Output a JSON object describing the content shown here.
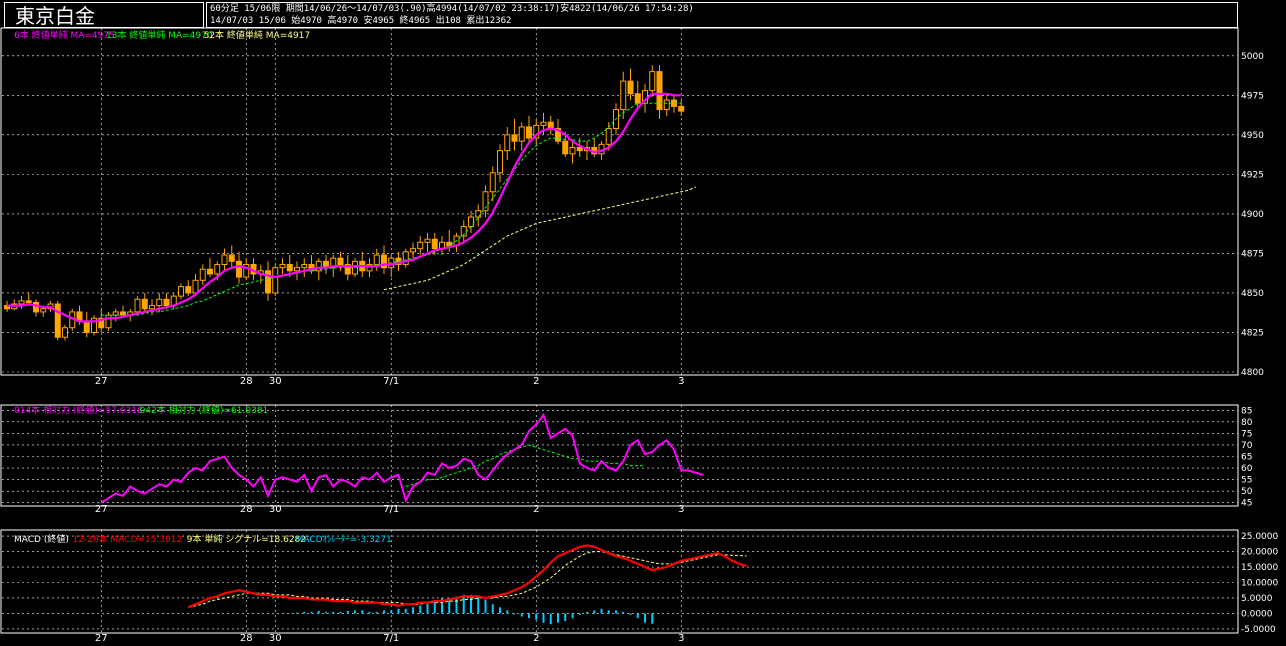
{
  "title": "東京白金",
  "info_line1": "60分足 15/06限 期間14/06/26～14/07/03(.90)高4994(14/07/02 23:38:17)安4822(14/06/26 17:54:28)",
  "info_line2": "14/07/03 15/06 始4970 高4970 安4965 終4965 出108 累出12362",
  "colors": {
    "up": "#ffa500",
    "down": "#ffa500",
    "ma1": "#ff00ff",
    "ma2": "#00ff00",
    "ma3": "#ffff80",
    "rsi1": "#ff00ff",
    "rsi2": "#00ff00",
    "macd": "#ff0000",
    "signal": "#ffff80",
    "osc": "#00ccff",
    "grid": "#ffffff"
  },
  "chart_data": [
    {
      "type": "candlestick",
      "legend": [
        {
          "text": "6本 終値単純 MA=4975",
          "color": "#ff00ff"
        },
        {
          "text": "13本 終値単純 MA=4970",
          "color": "#00ff00"
        },
        {
          "text": "52本 終値単純 MA=4917",
          "color": "#ffff80"
        }
      ],
      "ylim": [
        4800,
        5010
      ],
      "yticks": [
        4800,
        4825,
        4850,
        4875,
        4900,
        4925,
        4950,
        4975,
        5000
      ],
      "x_labels": [
        {
          "i": 13,
          "label": "27"
        },
        {
          "i": 33,
          "label": "28"
        },
        {
          "i": 37,
          "label": "30"
        },
        {
          "i": 53,
          "label": "7/1"
        },
        {
          "i": 73,
          "label": "2"
        },
        {
          "i": 93,
          "label": "3"
        }
      ],
      "candles": [
        [
          4842,
          4845,
          4838,
          4840
        ],
        [
          4840,
          4846,
          4839,
          4843
        ],
        [
          4843,
          4848,
          4840,
          4845
        ],
        [
          4845,
          4850,
          4842,
          4844
        ],
        [
          4844,
          4846,
          4835,
          4838
        ],
        [
          4838,
          4842,
          4835,
          4840
        ],
        [
          4840,
          4845,
          4838,
          4843
        ],
        [
          4843,
          4845,
          4820,
          4822
        ],
        [
          4822,
          4830,
          4820,
          4828
        ],
        [
          4828,
          4840,
          4826,
          4838
        ],
        [
          4838,
          4842,
          4830,
          4832
        ],
        [
          4832,
          4838,
          4822,
          4825
        ],
        [
          4825,
          4836,
          4823,
          4834
        ],
        [
          4834,
          4840,
          4825,
          4828
        ],
        [
          4828,
          4838,
          4826,
          4836
        ],
        [
          4836,
          4840,
          4832,
          4838
        ],
        [
          4838,
          4842,
          4835,
          4836
        ],
        [
          4836,
          4840,
          4832,
          4838
        ],
        [
          4838,
          4848,
          4836,
          4846
        ],
        [
          4846,
          4850,
          4838,
          4840
        ],
        [
          4840,
          4846,
          4836,
          4842
        ],
        [
          4842,
          4850,
          4838,
          4846
        ],
        [
          4846,
          4850,
          4840,
          4842
        ],
        [
          4842,
          4850,
          4840,
          4848
        ],
        [
          4848,
          4856,
          4846,
          4854
        ],
        [
          4854,
          4858,
          4848,
          4850
        ],
        [
          4850,
          4862,
          4848,
          4858
        ],
        [
          4858,
          4868,
          4855,
          4865
        ],
        [
          4865,
          4872,
          4860,
          4862
        ],
        [
          4862,
          4870,
          4858,
          4868
        ],
        [
          4868,
          4878,
          4864,
          4874
        ],
        [
          4874,
          4880,
          4866,
          4870
        ],
        [
          4870,
          4876,
          4856,
          4860
        ],
        [
          4860,
          4872,
          4858,
          4868
        ],
        [
          4868,
          4872,
          4858,
          4862
        ],
        [
          4862,
          4868,
          4856,
          4864
        ],
        [
          4864,
          4870,
          4845,
          4850
        ],
        [
          4850,
          4868,
          4848,
          4866
        ],
        [
          4866,
          4872,
          4862,
          4868
        ],
        [
          4868,
          4874,
          4860,
          4864
        ],
        [
          4864,
          4870,
          4858,
          4866
        ],
        [
          4866,
          4872,
          4860,
          4868
        ],
        [
          4868,
          4874,
          4862,
          4864
        ],
        [
          4864,
          4872,
          4858,
          4870
        ],
        [
          4870,
          4874,
          4862,
          4866
        ],
        [
          4866,
          4874,
          4860,
          4872
        ],
        [
          4872,
          4876,
          4864,
          4868
        ],
        [
          4868,
          4874,
          4858,
          4862
        ],
        [
          4862,
          4872,
          4860,
          4870
        ],
        [
          4870,
          4876,
          4860,
          4864
        ],
        [
          4864,
          4872,
          4860,
          4868
        ],
        [
          4868,
          4878,
          4864,
          4874
        ],
        [
          4874,
          4880,
          4862,
          4866
        ],
        [
          4866,
          4874,
          4860,
          4872
        ],
        [
          4872,
          4876,
          4864,
          4868
        ],
        [
          4868,
          4878,
          4866,
          4876
        ],
        [
          4876,
          4882,
          4872,
          4878
        ],
        [
          4878,
          4886,
          4874,
          4882
        ],
        [
          4882,
          4888,
          4876,
          4884
        ],
        [
          4884,
          4888,
          4874,
          4878
        ],
        [
          4878,
          4886,
          4874,
          4882
        ],
        [
          4882,
          4890,
          4876,
          4880
        ],
        [
          4880,
          4888,
          4876,
          4886
        ],
        [
          4886,
          4896,
          4882,
          4892
        ],
        [
          4892,
          4902,
          4888,
          4898
        ],
        [
          4898,
          4906,
          4892,
          4902
        ],
        [
          4902,
          4918,
          4898,
          4914
        ],
        [
          4914,
          4930,
          4908,
          4926
        ],
        [
          4926,
          4944,
          4920,
          4940
        ],
        [
          4940,
          4955,
          4934,
          4950
        ],
        [
          4950,
          4960,
          4940,
          4946
        ],
        [
          4946,
          4958,
          4940,
          4955
        ],
        [
          4955,
          4962,
          4944,
          4948
        ],
        [
          4948,
          4960,
          4944,
          4956
        ],
        [
          4956,
          4964,
          4950,
          4958
        ],
        [
          4958,
          4962,
          4950,
          4954
        ],
        [
          4954,
          4960,
          4944,
          4946
        ],
        [
          4946,
          4952,
          4936,
          4938
        ],
        [
          4938,
          4946,
          4932,
          4942
        ],
        [
          4942,
          4948,
          4936,
          4940
        ],
        [
          4940,
          4946,
          4934,
          4942
        ],
        [
          4942,
          4948,
          4936,
          4938
        ],
        [
          4938,
          4946,
          4934,
          4944
        ],
        [
          4944,
          4958,
          4940,
          4954
        ],
        [
          4954,
          4970,
          4950,
          4966
        ],
        [
          4966,
          4990,
          4960,
          4984
        ],
        [
          4984,
          4992,
          4972,
          4976
        ],
        [
          4976,
          4984,
          4966,
          4970
        ],
        [
          4970,
          4982,
          4964,
          4978
        ],
        [
          4978,
          4994,
          4974,
          4990
        ],
        [
          4990,
          4994,
          4960,
          4966
        ],
        [
          4966,
          4976,
          4962,
          4972
        ],
        [
          4972,
          4976,
          4964,
          4968
        ],
        [
          4968,
          4972,
          4962,
          4965
        ]
      ],
      "ma6": [
        4842,
        4842,
        4842,
        4843,
        4842,
        4841,
        4841,
        4838,
        4836,
        4834,
        4832,
        4832,
        4832,
        4833,
        4834,
        4834,
        4835,
        4836,
        4837,
        4838,
        4839,
        4840,
        4841,
        4842,
        4844,
        4846,
        4849,
        4853,
        4857,
        4860,
        4864,
        4866,
        4867,
        4866,
        4864,
        4862,
        4861,
        4860,
        4861,
        4862,
        4863,
        4864,
        4865,
        4866,
        4866,
        4867,
        4867,
        4867,
        4867,
        4867,
        4867,
        4867,
        4868,
        4868,
        4869,
        4870,
        4871,
        4873,
        4875,
        4877,
        4878,
        4879,
        4880,
        4882,
        4885,
        4889,
        4894,
        4901,
        4910,
        4920,
        4930,
        4938,
        4945,
        4950,
        4953,
        4954,
        4953,
        4950,
        4946,
        4943,
        4941,
        4939,
        4940,
        4942,
        4946,
        4952,
        4960,
        4967,
        4972,
        4976,
        4976,
        4976,
        4975,
        4975
      ],
      "ma13_start": 13,
      "ma13": [
        4836,
        4836,
        4836,
        4836,
        4836,
        4836,
        4837,
        4838,
        4838,
        4839,
        4840,
        4841,
        4842,
        4844,
        4845,
        4847,
        4849,
        4851,
        4853,
        4855,
        4856,
        4857,
        4858,
        4859,
        4860,
        4861,
        4862,
        4863,
        4864,
        4864,
        4865,
        4865,
        4866,
        4866,
        4866,
        4866,
        4867,
        4867,
        4868,
        4868,
        4869,
        4870,
        4871,
        4872,
        4873,
        4874,
        4876,
        4878,
        4880,
        4883,
        4887,
        4892,
        4898,
        4904,
        4910,
        4916,
        4922,
        4928,
        4934,
        4939,
        4943,
        4946,
        4948,
        4948,
        4947,
        4947,
        4946,
        4946,
        4948,
        4951,
        4955,
        4960,
        4964,
        4967,
        4970,
        4970,
        4970,
        4970,
        4970,
        4970,
        4970
      ],
      "ma52_start": 52,
      "ma52": [
        4852,
        4853,
        4854,
        4855,
        4856,
        4857,
        4858,
        4860,
        4862,
        4864,
        4866,
        4868,
        4871,
        4874,
        4877,
        4880,
        4883,
        4886,
        4888,
        4890,
        4892,
        4894,
        4895,
        4896,
        4897,
        4898,
        4899,
        4900,
        4901,
        4902,
        4903,
        4904,
        4905,
        4906,
        4907,
        4908,
        4909,
        4910,
        4911,
        4912,
        4913,
        4914,
        4915,
        4917
      ]
    },
    {
      "type": "line",
      "legend": [
        {
          "text": "014本 相対力 (終値)=57.6318",
          "color": "#ff00ff"
        },
        {
          "text": "042本 相対力 (終値)=61.0381",
          "color": "#00ff00"
        }
      ],
      "ylim": [
        44,
        86
      ],
      "yticks": [
        45,
        50,
        55,
        60,
        65,
        70,
        75,
        80,
        85
      ],
      "rsi14_start": 13,
      "rsi14": [
        45,
        47,
        49,
        48,
        52,
        50,
        49,
        51,
        53,
        52,
        55,
        54,
        58,
        60,
        59,
        63,
        64,
        65,
        60,
        57,
        55,
        52,
        56,
        48,
        55,
        56,
        55,
        54,
        57,
        50,
        56,
        57,
        52,
        55,
        54,
        52,
        56,
        55,
        58,
        54,
        56,
        57,
        46,
        52,
        54,
        58,
        57,
        62,
        60,
        61,
        64,
        63,
        57,
        55,
        59,
        63,
        66,
        68,
        70,
        76,
        79,
        83,
        73,
        75,
        77,
        74,
        62,
        60,
        59,
        63,
        60,
        59,
        63,
        70,
        72,
        66,
        67,
        70,
        72,
        68,
        59,
        59,
        58,
        57
      ],
      "rsi42_start": 55,
      "rsi42": [
        52,
        53,
        54,
        55,
        55,
        56,
        57,
        58,
        59,
        60,
        61,
        63,
        64,
        66,
        67,
        68,
        69,
        70,
        69,
        68,
        67,
        66,
        65,
        64,
        64,
        63,
        63,
        63,
        62,
        62,
        62,
        61,
        61,
        61
      ]
    },
    {
      "type": "bar+line",
      "legend": [
        {
          "text": "MACD (終値)",
          "color": "#ffffff"
        },
        {
          "text": "12-26本 MACD=15.3012",
          "color": "#ff0000"
        },
        {
          "text": "9本 単純 シグナル=18.6282",
          "color": "#ffff80"
        },
        {
          "text": "MACDｵｼﾚｰﾀｰ=-3.3271",
          "color": "#00ccff"
        }
      ],
      "ylim": [
        -6,
        26
      ],
      "yticks": [
        "25.0000",
        "20.0000",
        "15.0000",
        "10.0000",
        "5.0000",
        "0.0000",
        "-5.0000"
      ],
      "ytick_values": [
        25,
        20,
        15,
        10,
        5,
        0,
        -5
      ],
      "macd_start": 25,
      "macd": [
        2,
        3,
        4,
        5,
        5.5,
        6.5,
        7,
        7.5,
        7,
        6.5,
        6,
        6,
        5.5,
        5.5,
        5,
        5,
        5,
        4.5,
        4.5,
        4.5,
        4,
        4,
        4,
        3.5,
        3.5,
        3.5,
        3.5,
        3,
        3,
        2.5,
        3,
        3,
        3.5,
        3.5,
        4,
        4,
        4.5,
        5,
        5.5,
        5.5,
        5.5,
        5,
        5.5,
        6,
        6.5,
        7.5,
        8.5,
        10,
        12,
        14,
        16.5,
        18.5,
        19.5,
        20.5,
        21.5,
        22,
        21.5,
        20.5,
        19.5,
        18.5,
        18,
        17,
        16,
        15,
        14,
        14.5,
        15,
        16,
        17,
        17.5,
        18,
        18.5,
        19,
        19.5,
        18.5,
        17,
        16,
        15.3
      ],
      "signal_start": 25,
      "signal": [
        2,
        2.5,
        3,
        4,
        4.5,
        5,
        5.5,
        6,
        6.5,
        6.5,
        6.5,
        6.5,
        6,
        6,
        6,
        5.5,
        5.5,
        5,
        5,
        5,
        4.5,
        4.5,
        4.5,
        4,
        4,
        4,
        3.5,
        3.5,
        3.5,
        3.5,
        3,
        3,
        3,
        3.5,
        3.5,
        3.5,
        4,
        4,
        4.5,
        4.5,
        5,
        5,
        5,
        5.5,
        5.5,
        6,
        6.5,
        7.5,
        8.5,
        10,
        11.5,
        13.5,
        15.5,
        17,
        18.5,
        19.5,
        20,
        20,
        19.5,
        19,
        18.5,
        18,
        17.5,
        17,
        16.5,
        16,
        16,
        16,
        16.5,
        17,
        17.5,
        18,
        18.5,
        19,
        19,
        18.8,
        18.7,
        18.6
      ],
      "osc_start": 40,
      "osc": [
        0.3,
        0.5,
        0.5,
        0.8,
        0.5,
        0.5,
        0.5,
        0.8,
        1,
        1,
        0.5,
        0.5,
        1,
        1,
        1.5,
        1.5,
        2,
        2.5,
        3.5,
        4,
        5,
        5,
        5.5,
        6,
        6,
        5.5,
        4.5,
        3,
        2,
        1,
        0,
        -1,
        -1.5,
        -2,
        -3,
        -3.5,
        -3,
        -2.5,
        -1.5,
        -0.5,
        0.5,
        1,
        1.5,
        1,
        1,
        0.5,
        -0.5,
        -1.5,
        -3,
        -3.3
      ]
    }
  ]
}
